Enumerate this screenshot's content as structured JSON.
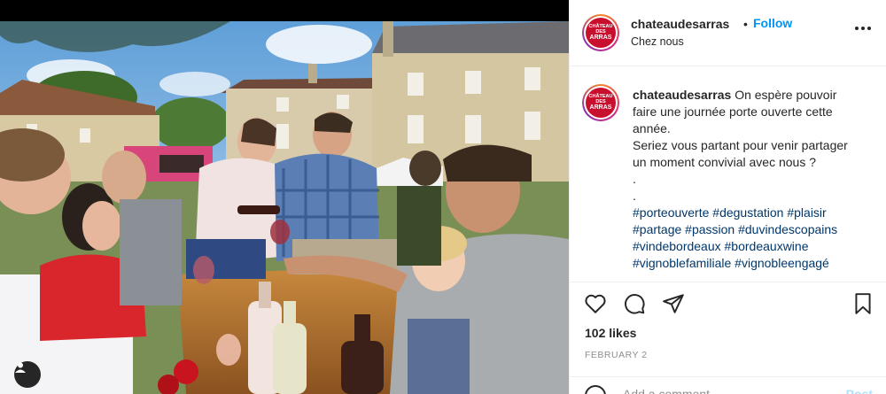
{
  "post": {
    "username": "chateaudesarras",
    "follow_label": "Follow",
    "separator": "•",
    "location": "Chez nous",
    "avatar_text_top": "CHÂTEAU DES",
    "avatar_text_bottom": "ARRAS",
    "caption_lines": [
      "On espère pouvoir",
      "faire une journée porte ouverte cette",
      "année.",
      "Seriez vous partant pour venir partager",
      "un moment convivial avec nous ?",
      ".",
      "."
    ],
    "hashtag_lines": [
      "#porteouverte #degustation #plaisir",
      "#partage #passion #duvindescopains",
      "#vindebordeaux #bordeauxwine",
      "#vignoblefamiliale #vignobleengagé"
    ],
    "likes": "102 likes",
    "date": "FEBRUARY 2",
    "comment_placeholder": "Add a comment...",
    "post_label": "Post"
  },
  "colors": {
    "brand": "#c8102e",
    "link": "#0095f6",
    "hashtag": "#00376b"
  },
  "icons": [
    "heart-icon",
    "comment-icon",
    "share-icon",
    "bookmark-icon",
    "more-icon",
    "user-tag-icon",
    "emoji-icon"
  ]
}
